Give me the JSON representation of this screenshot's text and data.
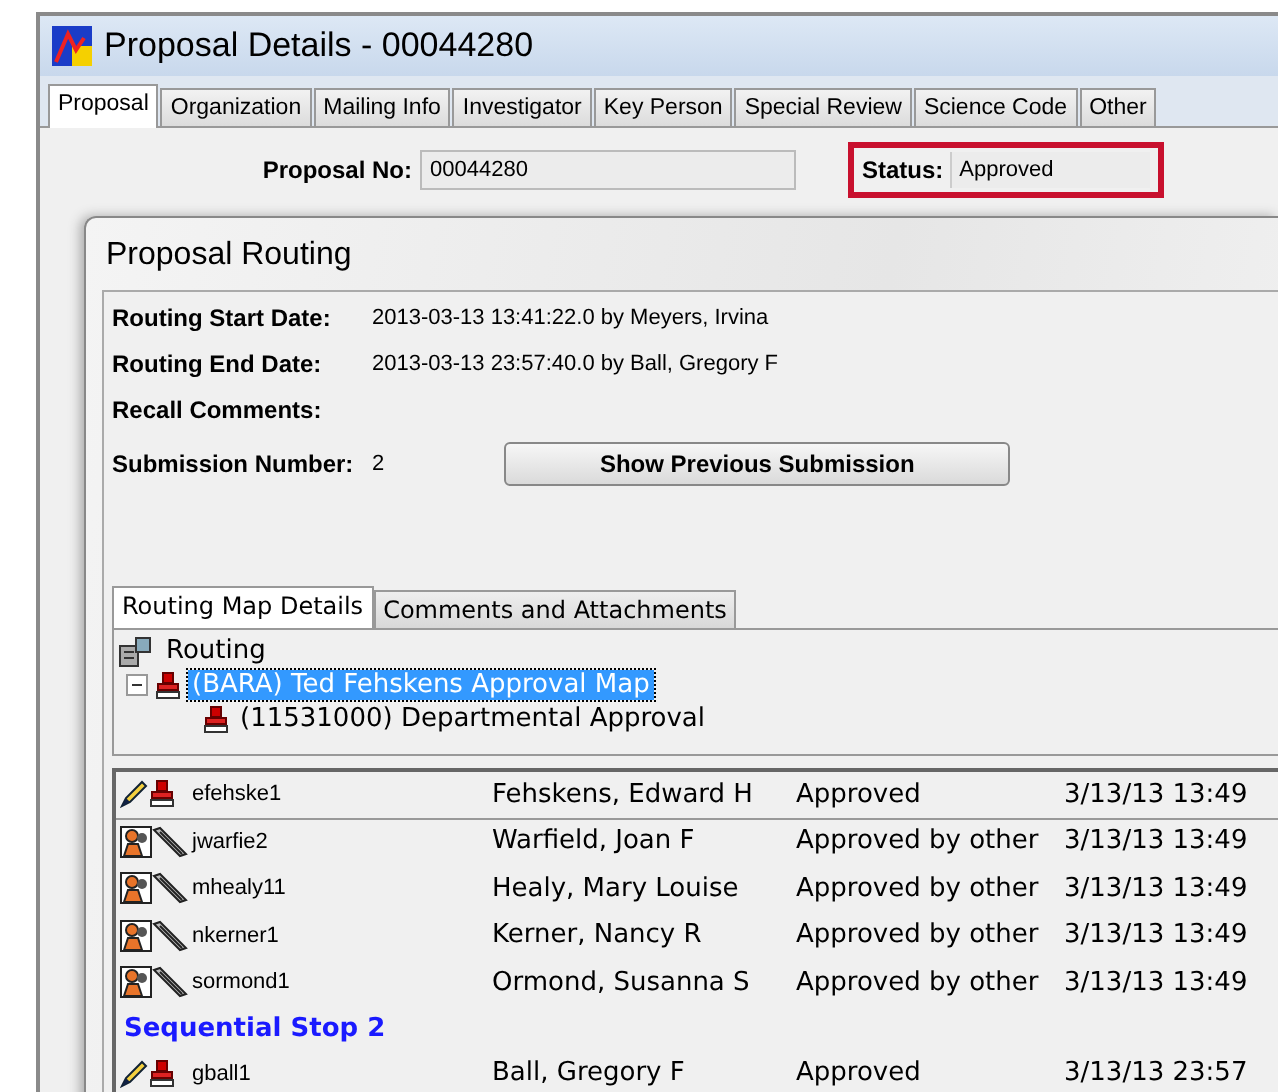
{
  "window": {
    "title": "Proposal Details - 00044280"
  },
  "tabs": [
    {
      "label": "Proposal",
      "selected": true
    },
    {
      "label": "Organization",
      "selected": false
    },
    {
      "label": "Mailing Info",
      "selected": false
    },
    {
      "label": "Investigator",
      "selected": false
    },
    {
      "label": "Key Person",
      "selected": false
    },
    {
      "label": "Special Review",
      "selected": false
    },
    {
      "label": "Science Code",
      "selected": false
    },
    {
      "label": "Other",
      "selected": false
    }
  ],
  "proposal": {
    "label": "Proposal No:",
    "value": "00044280"
  },
  "status": {
    "label": "Status:",
    "value": "Approved"
  },
  "dialog": {
    "title": "Proposal Routing",
    "fields": [
      {
        "label": "Routing Start Date:",
        "value": "2013-03-13 13:41:22.0 by Meyers, Irvina"
      },
      {
        "label": "Routing End Date:",
        "value": "2013-03-13 23:57:40.0 by Ball, Gregory F"
      },
      {
        "label": "Recall Comments:"
      },
      {
        "label": "Submission Number:",
        "value": "2"
      }
    ],
    "button": "Show Previous Submission",
    "tabs": [
      {
        "label": "Routing Map Details",
        "selected": true
      },
      {
        "label": "Comments and Attachments",
        "selected": false
      }
    ],
    "tree": [
      {
        "label": "Routing",
        "selected": false,
        "children": [
          {
            "label": "(BARA) Ted Fehskens Approval Map",
            "selected": true,
            "expanded": true,
            "children": [
              {
                "label": "(11531000) Departmental Approval",
                "selected": false
              }
            ]
          }
        ]
      }
    ],
    "rows": [
      {
        "kind": "approver",
        "user": "efehske1",
        "name": "Fehskens, Edward H",
        "status": "Approved",
        "date": "3/13/13 13:49"
      },
      {
        "kind": "alternate",
        "user": "jwarfie2",
        "name": "Warfield, Joan F",
        "status": "Approved by other",
        "date": "3/13/13 13:49"
      },
      {
        "kind": "alternate",
        "user": "mhealy11",
        "name": "Healy, Mary Louise",
        "status": "Approved by other",
        "date": "3/13/13 13:49"
      },
      {
        "kind": "alternate",
        "user": "nkerner1",
        "name": "Kerner, Nancy R",
        "status": "Approved by other",
        "date": "3/13/13 13:49"
      },
      {
        "kind": "alternate",
        "user": "sormond1",
        "name": "Ormond, Susanna S",
        "status": "Approved by other",
        "date": "3/13/13 13:49"
      },
      {
        "kind": "stop",
        "label": "Sequential Stop 2"
      },
      {
        "kind": "approver",
        "user": "gball1",
        "name": "Ball, Gregory F",
        "status": "Approved",
        "date": "3/13/13 23:57"
      }
    ]
  }
}
